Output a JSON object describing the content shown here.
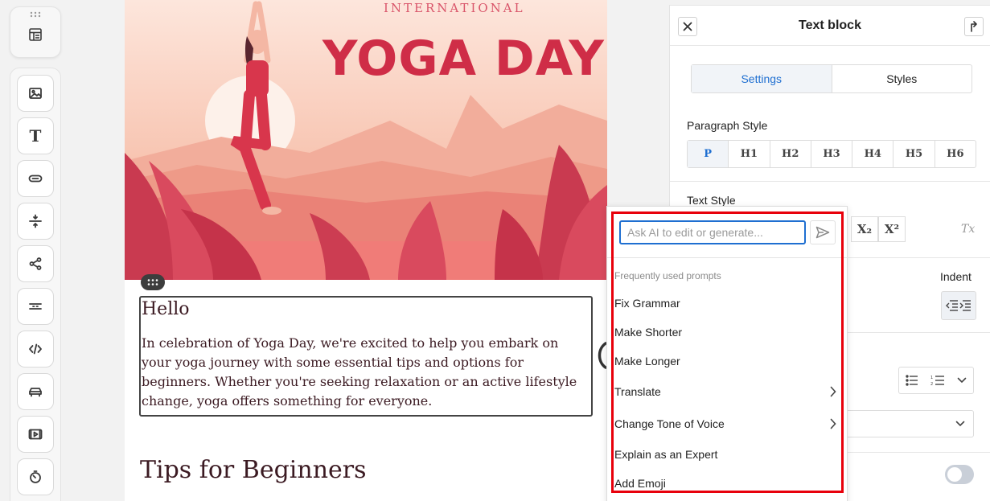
{
  "toolbar": {
    "top": {
      "icon": "layout-icon"
    },
    "tools": [
      {
        "name": "image",
        "icon": "image-icon"
      },
      {
        "name": "text",
        "icon": "text-icon",
        "glyph": "T"
      },
      {
        "name": "button",
        "icon": "button-icon"
      },
      {
        "name": "spacer",
        "icon": "spacer-icon"
      },
      {
        "name": "social",
        "icon": "share-icon"
      },
      {
        "name": "divider",
        "icon": "divider-icon"
      },
      {
        "name": "html",
        "icon": "code-icon",
        "glyph": "</>"
      },
      {
        "name": "car",
        "icon": "car-icon"
      },
      {
        "name": "video",
        "icon": "video-icon"
      },
      {
        "name": "timer",
        "icon": "timer-icon"
      }
    ]
  },
  "canvas": {
    "hero_subtitle": "INTERNATIONAL",
    "hero_title": "YOGA DAY",
    "text_block": {
      "heading": "Hello",
      "body": "In celebration of Yoga Day, we're excited to help you embark on your yoga journey with some essential tips and options for beginners. Whether you're seeking relaxation or an active lifestyle change, yoga offers something for everyone."
    },
    "tips_title": "Tips for Beginners"
  },
  "panel": {
    "title": "Text block",
    "tabs": [
      {
        "label": "Settings",
        "active": true
      },
      {
        "label": "Styles",
        "active": false
      }
    ],
    "paragraph_style_label": "Paragraph Style",
    "paragraph_styles": [
      "P",
      "H1",
      "H2",
      "H3",
      "H4",
      "H5",
      "H6"
    ],
    "text_style_label": "Text Style",
    "subscript_label": "X₂",
    "superscript_label": "X²",
    "clear_format_label": "Tx",
    "indent_label": "Indent"
  },
  "ai_popup": {
    "placeholder": "Ask AI to edit or generate...",
    "section_title": "Frequently used prompts",
    "items": [
      {
        "label": "Fix Grammar",
        "submenu": false
      },
      {
        "label": "Make Shorter",
        "submenu": false
      },
      {
        "label": "Make Longer",
        "submenu": false
      },
      {
        "label": "Translate",
        "submenu": true
      },
      {
        "label": "Change Tone of Voice",
        "submenu": true
      },
      {
        "label": "Explain as an Expert",
        "submenu": false
      },
      {
        "label": "Add Emoji",
        "submenu": false
      }
    ]
  },
  "colors": {
    "accent": "#1f6fd1",
    "highlight": "#e8000b",
    "yoga_red": "#cf2d47",
    "text_dark": "#3b1a22"
  }
}
